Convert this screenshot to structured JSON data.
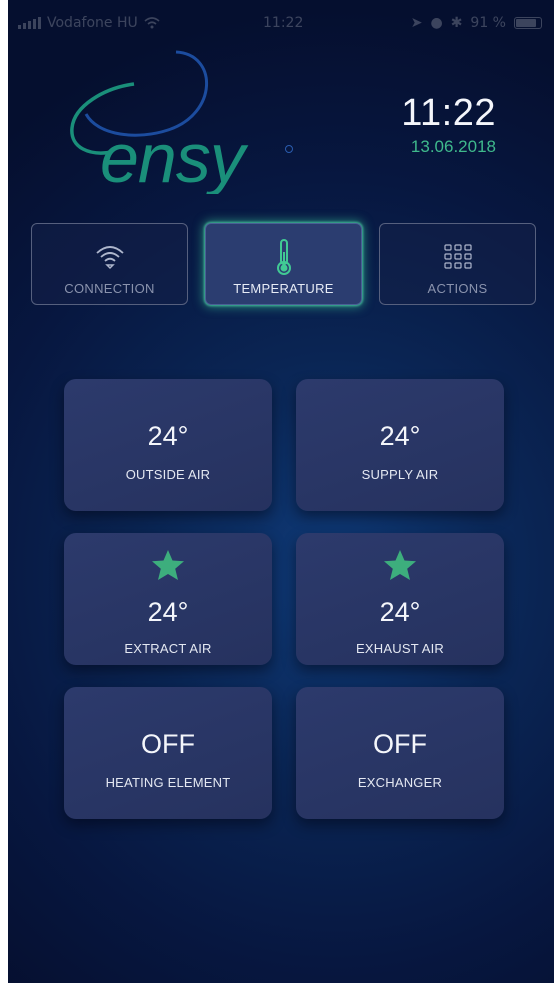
{
  "status_bar": {
    "carrier": "Vodafone HU",
    "network": "",
    "time": "11:22",
    "battery": "91 %"
  },
  "brand": {
    "logo_text": "ensy",
    "swirl_color": "#1a8f7a"
  },
  "clock": {
    "time": "11:22",
    "date": "13.06.2018",
    "date_color": "#3fb98c"
  },
  "tabs": [
    {
      "label": "CONNECTION",
      "icon": "wifi-icon",
      "active": false
    },
    {
      "label": "TEMPERATURE",
      "icon": "thermometer-icon",
      "active": true
    },
    {
      "label": "ACTIONS",
      "icon": "grid-icon",
      "active": false
    }
  ],
  "tiles": [
    {
      "value": "24°",
      "label": "OUTSIDE AIR",
      "starred": false
    },
    {
      "value": "24°",
      "label": "SUPPLY AIR",
      "starred": false
    },
    {
      "value": "24°",
      "label": "EXTRACT AIR",
      "starred": true
    },
    {
      "value": "24°",
      "label": "EXHAUST AIR",
      "starred": true
    },
    {
      "value": "OFF",
      "label": "HEATING ELEMENT",
      "starred": false
    },
    {
      "value": "OFF",
      "label": "EXCHANGER",
      "starred": false
    }
  ],
  "colors": {
    "accent": "#3fb98c",
    "star": "#3dae7d",
    "tile": "#2a376a",
    "background": "#07173f"
  }
}
